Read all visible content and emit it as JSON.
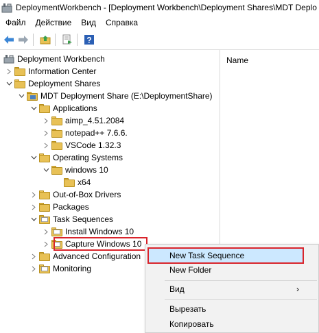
{
  "window": {
    "title": "DeploymentWorkbench - [Deployment Workbench\\Deployment Shares\\MDT Deplo"
  },
  "menu": [
    "Файл",
    "Действие",
    "Вид",
    "Справка"
  ],
  "toolbar": {
    "icons": [
      "back-arrow-icon",
      "forward-arrow-icon",
      "up-folder-icon",
      "export-list-icon",
      "help-icon"
    ],
    "colors": {
      "arrow": "#3b86d6",
      "help_bg": "#2b5fb4"
    }
  },
  "tree": {
    "root": "Deployment Workbench",
    "information_center": "Information Center",
    "deployment_shares": "Deployment Shares",
    "share": "MDT Deployment Share (E:\\DeploymentShare)",
    "applications": "Applications",
    "app_items": [
      "aimp_4.51.2084",
      "notepad++ 7.6.6.",
      "VSCode 1.32.3"
    ],
    "operating_systems": "Operating Systems",
    "os_folder": "windows 10",
    "os_subfolder": "x64",
    "drivers": "Out-of-Box Drivers",
    "packages": "Packages",
    "task_sequences": "Task Sequences",
    "ts_items": [
      "Install Windows 10",
      "Capture Windows 10"
    ],
    "advanced": "Advanced Configuration",
    "monitoring": "Monitoring"
  },
  "right_pane": {
    "column_header": "Name"
  },
  "context_menu": {
    "new_task_sequence": "New Task Sequence",
    "new_folder": "New Folder",
    "view": "Вид",
    "view_arrow": "›",
    "cut": "Вырезать",
    "copy": "Копировать"
  },
  "colors": {
    "highlight": "#cce8ff",
    "outline": "#d9242b",
    "folder": "#e8c156"
  }
}
